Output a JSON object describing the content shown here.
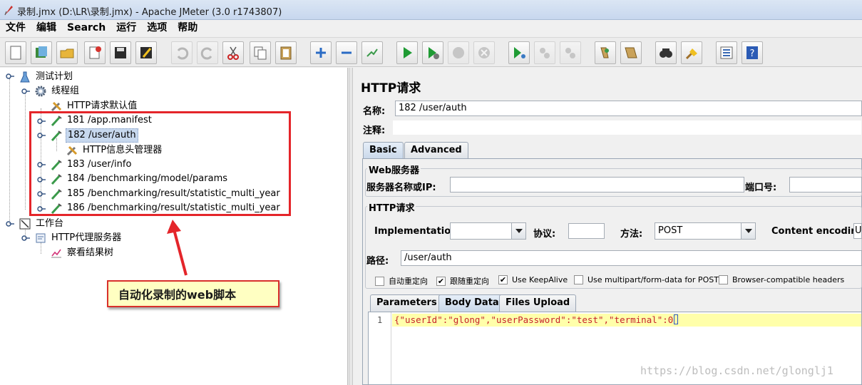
{
  "window": {
    "title": "录制.jmx (D:\\LR\\录制.jmx) - Apache JMeter (3.0 r1743807)"
  },
  "menu": [
    "文件",
    "编辑",
    "Search",
    "运行",
    "选项",
    "帮助"
  ],
  "toolbar": {
    "icons": [
      "new-icon",
      "templates-icon",
      "open-icon",
      "close-icon",
      "save-icon",
      "save-as-icon",
      "undo-icon",
      "redo-icon",
      "cut-icon",
      "copy-icon",
      "paste-icon",
      "expand-icon",
      "collapse-icon",
      "toggle-icon",
      "start-icon",
      "start-no-timers-icon",
      "stop-icon",
      "shutdown-icon",
      "remote-start-icon",
      "remote-stop-icon",
      "remote-shutdown-icon",
      "clear-icon",
      "clear-all-icon",
      "search-icon",
      "reset-search-icon",
      "function-helper-icon",
      "help-icon"
    ]
  },
  "tree": {
    "nodes": [
      {
        "label": "测试计划"
      },
      {
        "label": "线程组"
      },
      {
        "label": "HTTP请求默认值"
      },
      {
        "label": "181 /app.manifest"
      },
      {
        "label": "182 /user/auth"
      },
      {
        "label": "HTTP信息头管理器"
      },
      {
        "label": "183 /user/info"
      },
      {
        "label": "184 /benchmarking/model/params"
      },
      {
        "label": "185 /benchmarking/result/statistic_multi_year"
      },
      {
        "label": "186 /benchmarking/result/statistic_multi_year"
      },
      {
        "label": "工作台"
      },
      {
        "label": "HTTP代理服务器"
      },
      {
        "label": "察看结果树"
      }
    ],
    "annotation": "自动化录制的web脚本"
  },
  "panel": {
    "title": "HTTP请求",
    "name_label": "名称:",
    "name_value": "182 /user/auth",
    "comment_label": "注释:",
    "tabs": [
      "Basic",
      "Advanced"
    ],
    "web_server": {
      "group_title": "Web服务器",
      "server_label": "服务器名称或IP:",
      "port_label": "端口号:"
    },
    "http_request": {
      "group_title": "HTTP请求",
      "implementation_label": "Implementation:",
      "protocol_label": "协议:",
      "method_label": "方法:",
      "method_value": "POST",
      "encoding_label": "Content encoding:",
      "encoding_value": "U",
      "path_label": "路径:",
      "path_value": "/user/auth"
    },
    "checkboxes": [
      {
        "label": "自动重定向",
        "checked": false
      },
      {
        "label": "跟随重定向",
        "checked": true
      },
      {
        "label": "Use KeepAlive",
        "checked": true
      },
      {
        "label": "Use multipart/form-data for POST",
        "checked": false
      },
      {
        "label": "Browser-compatible headers",
        "checked": false
      }
    ],
    "sub_tabs": [
      "Parameters",
      "Body Data",
      "Files Upload"
    ],
    "body": {
      "line_number": "1",
      "code": "{\"userId\":\"glong\",\"userPassword\":\"test\",\"terminal\":0"
    }
  },
  "watermark": "https://blog.csdn.net/glonglj1"
}
